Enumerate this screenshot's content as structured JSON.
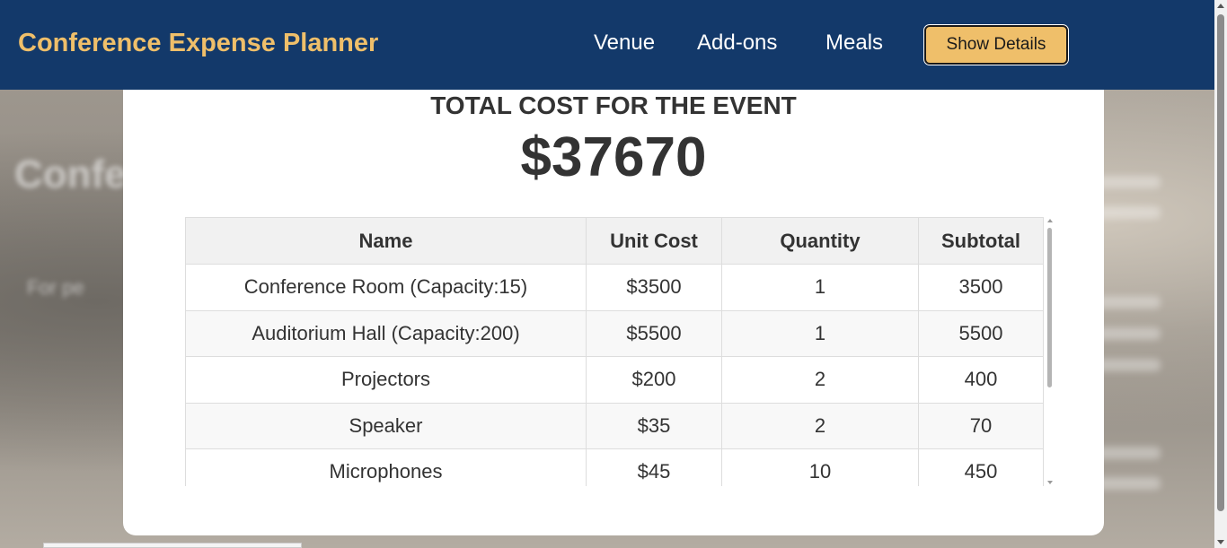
{
  "header": {
    "brand": "Conference Expense Planner",
    "nav": [
      "Venue",
      "Add-ons",
      "Meals"
    ],
    "details_button": "Show Details"
  },
  "background": {
    "headline": "Confe",
    "subtext": "For pe"
  },
  "summary": {
    "title": "TOTAL COST FOR THE EVENT",
    "amount": "$37670"
  },
  "table": {
    "headers": [
      "Name",
      "Unit Cost",
      "Quantity",
      "Subtotal"
    ],
    "rows": [
      [
        "Conference Room (Capacity:15)",
        "$3500",
        "1",
        "3500"
      ],
      [
        "Auditorium Hall (Capacity:200)",
        "$5500",
        "1",
        "5500"
      ],
      [
        "Projectors",
        "$200",
        "2",
        "400"
      ],
      [
        "Speaker",
        "$35",
        "2",
        "70"
      ],
      [
        "Microphones",
        "$45",
        "10",
        "450"
      ]
    ]
  },
  "colors": {
    "navbar": "#13396a",
    "brand": "#efbf6a",
    "button": "#efbf6a",
    "text": "#333333"
  }
}
